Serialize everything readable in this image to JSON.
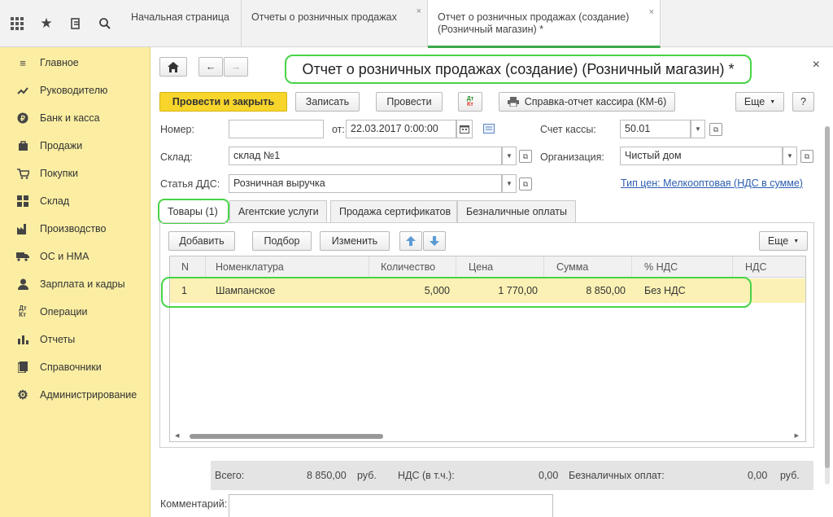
{
  "topbar": {
    "icons": [
      "apps-grid-icon",
      "star-icon",
      "history-icon",
      "search-icon"
    ],
    "tabs": [
      {
        "label": "Начальная страница"
      },
      {
        "label": "Отчеты о розничных продажах",
        "close": "×"
      },
      {
        "label_line1": "Отчет о розничных продажах (создание)",
        "label_line2": "(Розничный магазин) *",
        "close": "×",
        "active": true
      }
    ]
  },
  "sidebar": {
    "items": [
      {
        "label": "Главное",
        "icon": "menu-icon"
      },
      {
        "label": "Руководителю",
        "icon": "trend-icon"
      },
      {
        "label": "Банк и касса",
        "icon": "coin-icon"
      },
      {
        "label": "Продажи",
        "icon": "bag-icon"
      },
      {
        "label": "Покупки",
        "icon": "cart-icon"
      },
      {
        "label": "Склад",
        "icon": "warehouse-icon"
      },
      {
        "label": "Производство",
        "icon": "factory-icon"
      },
      {
        "label": "ОС и НМА",
        "icon": "truck-icon"
      },
      {
        "label": "Зарплата и кадры",
        "icon": "person-icon"
      },
      {
        "label": "Операции",
        "icon": "dt-kt-icon"
      },
      {
        "label": "Отчеты",
        "icon": "bar-chart-icon"
      },
      {
        "label": "Справочники",
        "icon": "book-icon"
      },
      {
        "label": "Администрирование",
        "icon": "gear-icon"
      }
    ]
  },
  "form": {
    "title": "Отчет о розничных продажах (создание) (Розничный магазин) *",
    "close": "×",
    "toolbar": {
      "post_close": "Провести и закрыть",
      "save": "Записать",
      "post": "Провести",
      "cash_report": "Справка-отчет кассира (КМ-6)",
      "more": "Еще",
      "help": "?"
    },
    "number_label": "Номер:",
    "number_value": "",
    "date_label": "от:",
    "date_value": "22.03.2017  0:00:00",
    "cash_account_label": "Счет кассы:",
    "cash_account_value": "50.01",
    "warehouse_label": "Склад:",
    "warehouse_value": "склад №1",
    "org_label": "Организация:",
    "org_value": "Чистый дом",
    "dds_label": "Статья ДДС:",
    "dds_value": "Розничная выручка",
    "price_type_link": "Тип цен: Мелкооптовая (НДС в сумме)"
  },
  "form_tabs": [
    {
      "label": "Товары (1)"
    },
    {
      "label": "Агентские услуги"
    },
    {
      "label": "Продажа сертификатов"
    },
    {
      "label": "Безналичные оплаты"
    }
  ],
  "table_toolbar": {
    "add": "Добавить",
    "pick": "Подбор",
    "edit": "Изменить",
    "more": "Еще"
  },
  "table": {
    "columns": [
      "N",
      "Номенклатура",
      "Количество",
      "Цена",
      "Сумма",
      "% НДС",
      "НДС"
    ],
    "rows": [
      {
        "n": "1",
        "name": "Шампанское",
        "qty": "5,000",
        "price": "1 770,00",
        "sum": "8 850,00",
        "vat_rate": "Без НДС",
        "vat": ""
      }
    ]
  },
  "totals": {
    "total_label": "Всего:",
    "total_value": "8 850,00",
    "total_cur": "руб.",
    "vat_label": "НДС (в т.ч.):",
    "vat_value": "0,00",
    "noncash_label": "Безналичных оплат:",
    "noncash_value": "0,00",
    "noncash_cur": "руб."
  },
  "comment_label": "Комментарий:",
  "colors": {
    "accent_yellow": "#f7d52b",
    "sidebar_bg": "#fbeea3",
    "highlight_green": "#47d447",
    "row_selected": "#fbf1b5",
    "link": "#2a5db0"
  }
}
